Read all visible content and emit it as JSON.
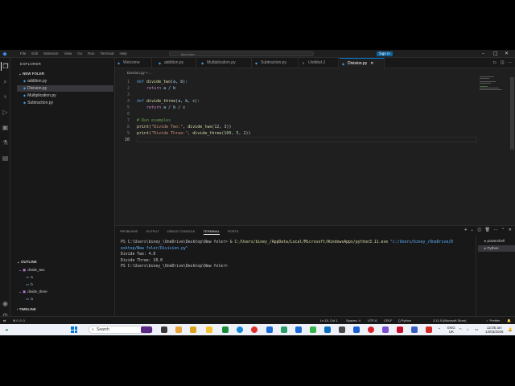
{
  "titlebar": {
    "menu": [
      "File",
      "Edit",
      "Selection",
      "View",
      "Go",
      "Run",
      "Terminal",
      "Help"
    ],
    "search_text": "New foler",
    "signin": "Sign in"
  },
  "sidebar": {
    "title": "EXPLORER",
    "folder": "NEW FOLER",
    "files": [
      "addition.py",
      "Division.py",
      "Multiplication.py",
      "Subtraction.py"
    ],
    "outline_title": "OUTLINE",
    "outline": [
      "divide_two",
      "a",
      "b",
      "divide_three",
      "a"
    ],
    "timeline_title": "TIMELINE"
  },
  "tabs": [
    "Welcome",
    "addition.py",
    "Multiplication.py",
    "Subtraction.py",
    "Untitled-1",
    "Division.py"
  ],
  "breadcrumb": "Division.py > ...",
  "code": {
    "line_numbers": [
      "1",
      "2",
      "3",
      "4",
      "5",
      "6",
      "7",
      "8",
      "9",
      "10"
    ]
  },
  "panel": {
    "tabs": [
      "PROBLEMS",
      "OUTPUT",
      "DEBUG CONSOLE",
      "TERMINAL",
      "PORTS"
    ],
    "terminal_lines": {
      "l1_prompt": "PS C:\\Users\\biney_\\OneDrive\\Desktop\\New foler> & ",
      "l1_exe": "C:/Users/biney_/AppData/Local/Microsoft/WindowsApps/python3.11.exe",
      "l1_arg": " \"c:/Users/biney_/OneDrive/D",
      "l2_arg": "esktop/New foler/Division.py\"",
      "l3": "Divide Two: 4.0",
      "l4": "Divide Three: 10.0",
      "l5": "PS C:\\Users\\biney_\\OneDrive\\Desktop\\New foler> "
    },
    "terminals": [
      "powershell",
      "Python"
    ]
  },
  "status": {
    "errors": "⊗ 0 ⚠ 0",
    "cursor": "Ln 10, Col 1",
    "spaces": "Spaces: 4",
    "encoding": "UTF-8",
    "eol": "CRLF",
    "language": "{} Python",
    "interpreter": "3.11.9 (Microsoft Store)",
    "prettier": "✓ Prettier"
  },
  "taskbar": {
    "search": "Search",
    "lang": "ENG",
    "region": "UK",
    "time": "12:05 am",
    "date": "14/03/2026"
  },
  "colors": {
    "accent": "#0078d4",
    "editor_bg": "#1f1f1f",
    "sidebar_bg": "#181818"
  }
}
